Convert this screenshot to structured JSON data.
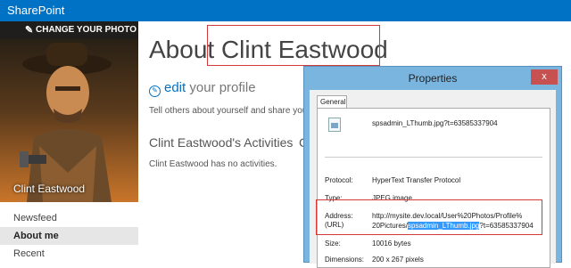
{
  "app": {
    "brand": "SharePoint"
  },
  "profile": {
    "change_photo": "CHANGE YOUR PHOTO",
    "name": "Clint Eastwood"
  },
  "nav": [
    {
      "label": "Newsfeed",
      "active": false
    },
    {
      "label": "About me",
      "active": true
    },
    {
      "label": "Recent",
      "active": false
    }
  ],
  "main": {
    "title": "About Clint Eastwood",
    "edit_link": "edit",
    "edit_rest": "your profile",
    "tell_others": "Tell others about yourself and share you",
    "activities_heading": "Clint Eastwood's Activities",
    "activities_trailing": "C",
    "no_activities": "Clint Eastwood has no activities."
  },
  "properties": {
    "title": "Properties",
    "close": "x",
    "tab": "General",
    "filename": "spsadmin_LThumb.jpg?t=63585337904",
    "protocol_label": "Protocol:",
    "protocol_value": "HyperText Transfer Protocol",
    "type_label": "Type:",
    "type_value": "JPEG image",
    "address_label": "Address:",
    "address_label2": "(URL)",
    "address_line1": "http://mysite.dev.local/User%20Photos/Profile%",
    "address_line2_pre": "20Pictures/",
    "address_line2_sel": "spsadmin_LThumb.jpg",
    "address_line2_post": "?t=63585337904",
    "size_label": "Size:",
    "size_value": "10016 bytes",
    "dimensions_label": "Dimensions:",
    "dimensions_value": "200 x 267 pixels"
  },
  "colors": {
    "brand_blue": "#0072c6",
    "highlight": "#d23a3a",
    "selection": "#3399ff"
  }
}
